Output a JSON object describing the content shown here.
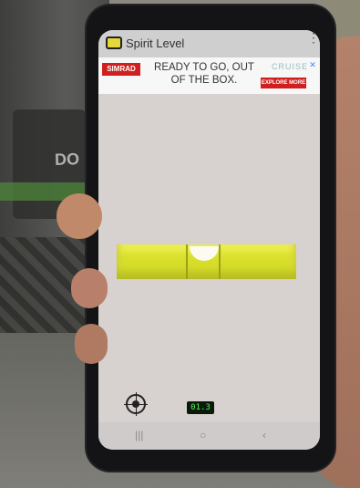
{
  "app": {
    "title": "Spirit Level"
  },
  "ad": {
    "logo": "SIMRAD",
    "headline_line1": "READY TO GO, OUT",
    "headline_line2": "OF THE BOX.",
    "brand": "CRUISE",
    "cta": "EXPLORE MORE"
  },
  "readout": {
    "value": "01.3"
  },
  "background": {
    "sign_text": "DO NO"
  },
  "icons": {
    "app_icon": "level-icon",
    "target": "crosshair-icon",
    "menu": "overflow-menu-icon",
    "ad_close": "close-icon",
    "nav_recents": "recents-icon",
    "nav_home": "home-icon",
    "nav_back": "back-icon"
  },
  "colors": {
    "level": "#d8de2a",
    "readout_text": "#5ef05a",
    "ad_red": "#d11f1f"
  }
}
